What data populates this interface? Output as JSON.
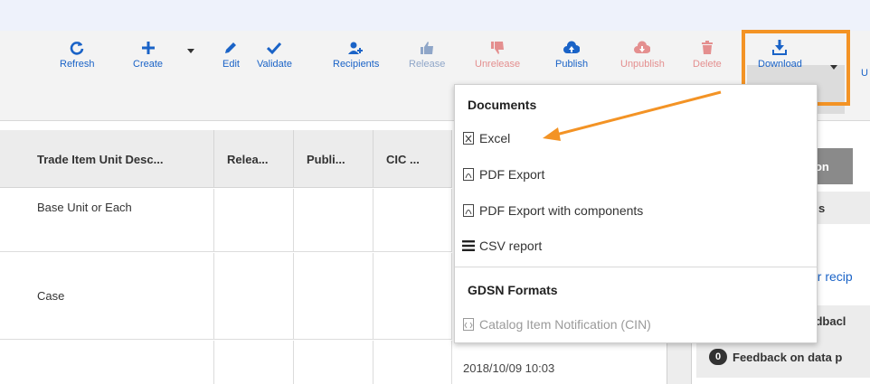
{
  "toolbar": {
    "refresh": "Refresh",
    "create": "Create",
    "edit": "Edit",
    "validate": "Validate",
    "recipients": "Recipients",
    "release": "Release",
    "unrelease": "Unrelease",
    "publish": "Publish",
    "unpublish": "Unpublish",
    "delete": "Delete",
    "download": "Download",
    "overflow": "U"
  },
  "table": {
    "headers": [
      "Trade Item Unit Desc...",
      "Relea...",
      "Publi...",
      "CIC ..."
    ],
    "rows": [
      [
        "Base Unit or Each",
        "",
        "",
        ""
      ],
      [
        "Case",
        "",
        "",
        ""
      ],
      [
        "",
        "",
        "",
        ""
      ]
    ]
  },
  "right_panel": {
    "tab_label": "tion",
    "section_header": "s",
    "link_fragment": "er recip",
    "feedback_label": "eedbacl",
    "feedback_count": "0",
    "feedback_on_data": "Feedback on data p"
  },
  "timestamp": "2018/10/09 10:03",
  "dropdown": {
    "documents_heading": "Documents",
    "items": [
      "Excel",
      "PDF Export",
      "PDF Export with components",
      "CSV report"
    ],
    "gdsn_heading": "GDSN Formats",
    "gdsn_items": [
      "Catalog Item Notification (CIN)"
    ]
  },
  "colors": {
    "accent_blue": "#1a63c7",
    "highlight_orange": "#f39325",
    "disabled_red": "#e48f8f"
  }
}
